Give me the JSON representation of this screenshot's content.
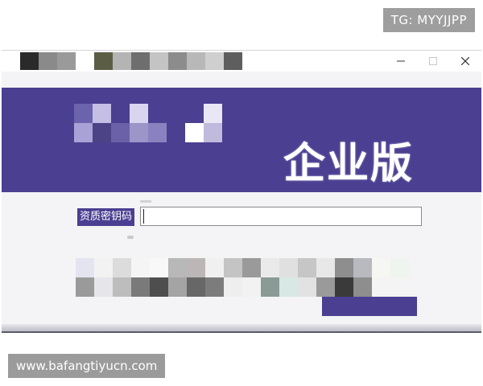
{
  "watermarks": {
    "top_right": "TG: MYYJJPP",
    "bottom_left": "www.bafangtiyucn.com"
  },
  "window": {
    "controls": {
      "minimize_icon": "minimize-icon",
      "maximize_icon": "maximize-icon",
      "close_icon": "close-icon"
    },
    "banner": {
      "edition_text": "企业版"
    },
    "license": {
      "label": "资质密钥码",
      "value": "",
      "placeholder": ""
    }
  },
  "colors": {
    "accent": "#4a3f91",
    "titlebar": "#ffffff",
    "window_background": "#f4f4f6"
  }
}
